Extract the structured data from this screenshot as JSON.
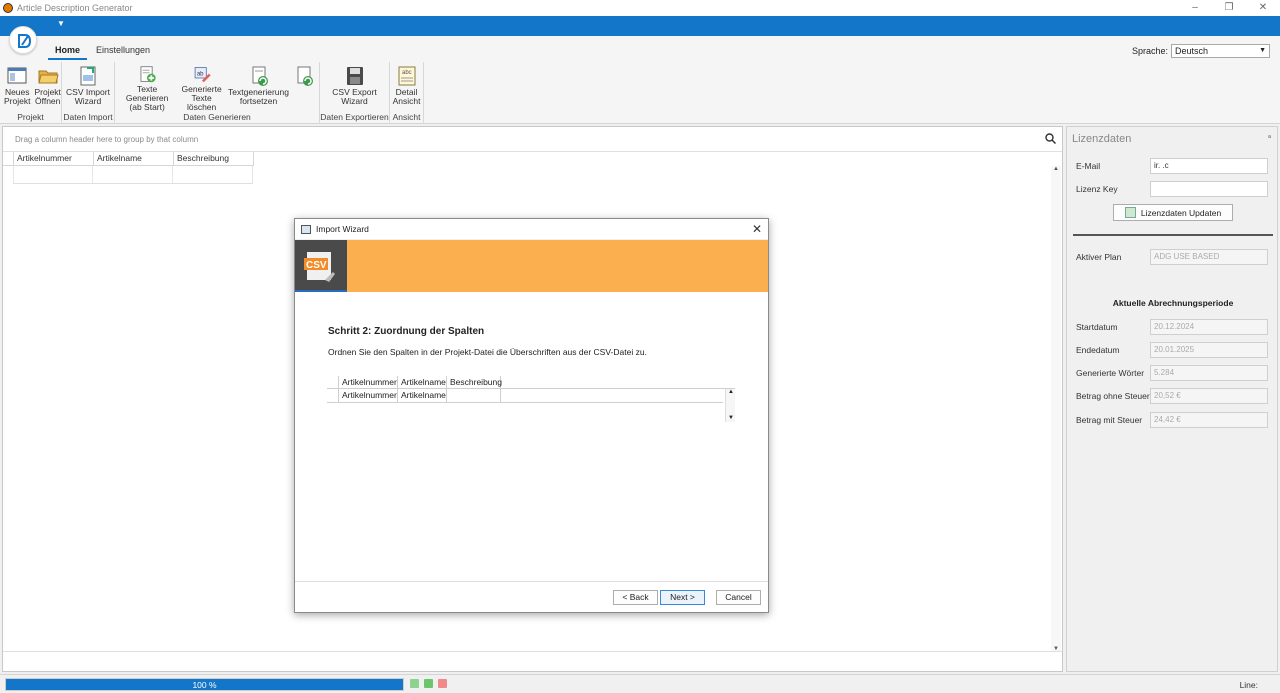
{
  "window": {
    "title": "Article Description Generator",
    "controls": [
      "–",
      "❐",
      "✕"
    ]
  },
  "ribbon": {
    "tabs": [
      "Home",
      "Einstellungen"
    ],
    "language_label": "Sprache:",
    "language_value": "Deutsch",
    "groups": [
      {
        "label": "Projekt",
        "buttons": [
          {
            "line1": "Neues",
            "line2": "Projekt",
            "icon": "new-project-icon"
          },
          {
            "line1": "Projekt",
            "line2": "Öffnen",
            "icon": "open-folder-icon"
          }
        ]
      },
      {
        "label": "Daten Import",
        "buttons": [
          {
            "line1": "CSV Import",
            "line2": "Wizard",
            "icon": "csv-import-icon"
          }
        ]
      },
      {
        "label": "Daten Generieren",
        "buttons": [
          {
            "line1": "Texte Generieren",
            "line2": "(ab Start)",
            "icon": "generate-text-icon"
          },
          {
            "line1": "Generierte",
            "line2": "Texte löschen",
            "icon": "delete-text-icon"
          },
          {
            "line1": "Textgenerierung",
            "line2": "fortsetzen",
            "icon": "continue-generation-icon"
          },
          {
            "line1": "",
            "line2": "",
            "icon": "refresh-generation-icon"
          }
        ]
      },
      {
        "label": "Daten Exportieren",
        "buttons": [
          {
            "line1": "CSV Export",
            "line2": "Wizard",
            "icon": "csv-export-icon"
          }
        ]
      },
      {
        "label": "Ansicht",
        "buttons": [
          {
            "line1": "Detail",
            "line2": "Ansicht",
            "icon": "detail-view-icon"
          }
        ]
      }
    ]
  },
  "grid": {
    "group_hint": "Drag a column header here to group by that column",
    "columns": [
      "Artikelnummer",
      "Artikelname",
      "Beschreibung"
    ]
  },
  "license": {
    "title": "Lizenzdaten",
    "email_label": "E-Mail",
    "email_value": "ir.                    .c",
    "key_label": "Lizenz Key",
    "key_value": "",
    "update_button": "Lizenzdaten Updaten",
    "plan_label": "Aktiver Plan",
    "plan_value": "ADG USE BASED",
    "period_heading": "Aktuelle Abrechnungsperiode",
    "fields": [
      {
        "label": "Startdatum",
        "value": "20.12.2024"
      },
      {
        "label": "Endedatum",
        "value": "20.01.2025"
      },
      {
        "label": "Generierte Wörter",
        "value": "5.284"
      },
      {
        "label": "Betrag ohne Steuer",
        "value": "20,52 €"
      },
      {
        "label": "Betrag mit Steuer",
        "value": "24,42 €"
      }
    ]
  },
  "status": {
    "progress_text": "100 %",
    "progress": 1.0,
    "line_label": "Line:"
  },
  "wizard": {
    "title": "Import Wizard",
    "step_title": "Schritt 2: Zuordnung der Spalten",
    "description": "Ordnen Sie den Spalten in der Projekt-Datei die Überschriften aus der CSV-Datei zu.",
    "mapping_headers": [
      "Artikelnummer",
      "Artikelname",
      "Beschreibung"
    ],
    "mapping_values": [
      "Artikelnummer",
      "Artikelname",
      ""
    ],
    "back_label": "< Back",
    "next_label": "Next >",
    "cancel_label": "Cancel",
    "banner_color": "#fcaf4e"
  },
  "colors": {
    "accent": "#1376c9"
  }
}
